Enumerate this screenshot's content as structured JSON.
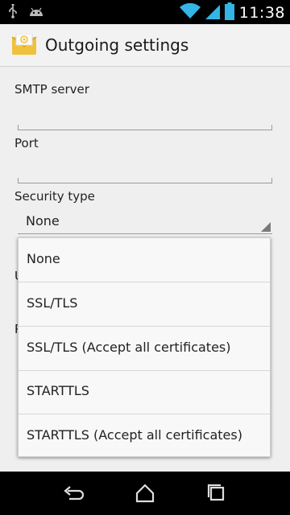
{
  "status_bar": {
    "time": "11:38",
    "icons": [
      "usb-icon",
      "android-icon",
      "wifi-icon",
      "signal-icon",
      "battery-icon"
    ]
  },
  "action_bar": {
    "title": "Outgoing settings",
    "icon": "email-app-icon"
  },
  "form": {
    "smtp_label": "SMTP server",
    "smtp_value": "",
    "port_label": "Port",
    "port_value": "",
    "security_label": "Security type",
    "security_value": "None",
    "hidden_label_1": "U",
    "hidden_label_2": "P"
  },
  "dropdown": {
    "options": [
      "None",
      "SSL/TLS",
      "SSL/TLS (Accept all certificates)",
      "STARTTLS",
      "STARTTLS (Accept all certificates)"
    ]
  },
  "nav_bar": {
    "icons": [
      "back-icon",
      "home-icon",
      "recents-icon"
    ]
  },
  "colors": {
    "accent": "#33b5e5",
    "app_icon": "#f0c23b"
  }
}
